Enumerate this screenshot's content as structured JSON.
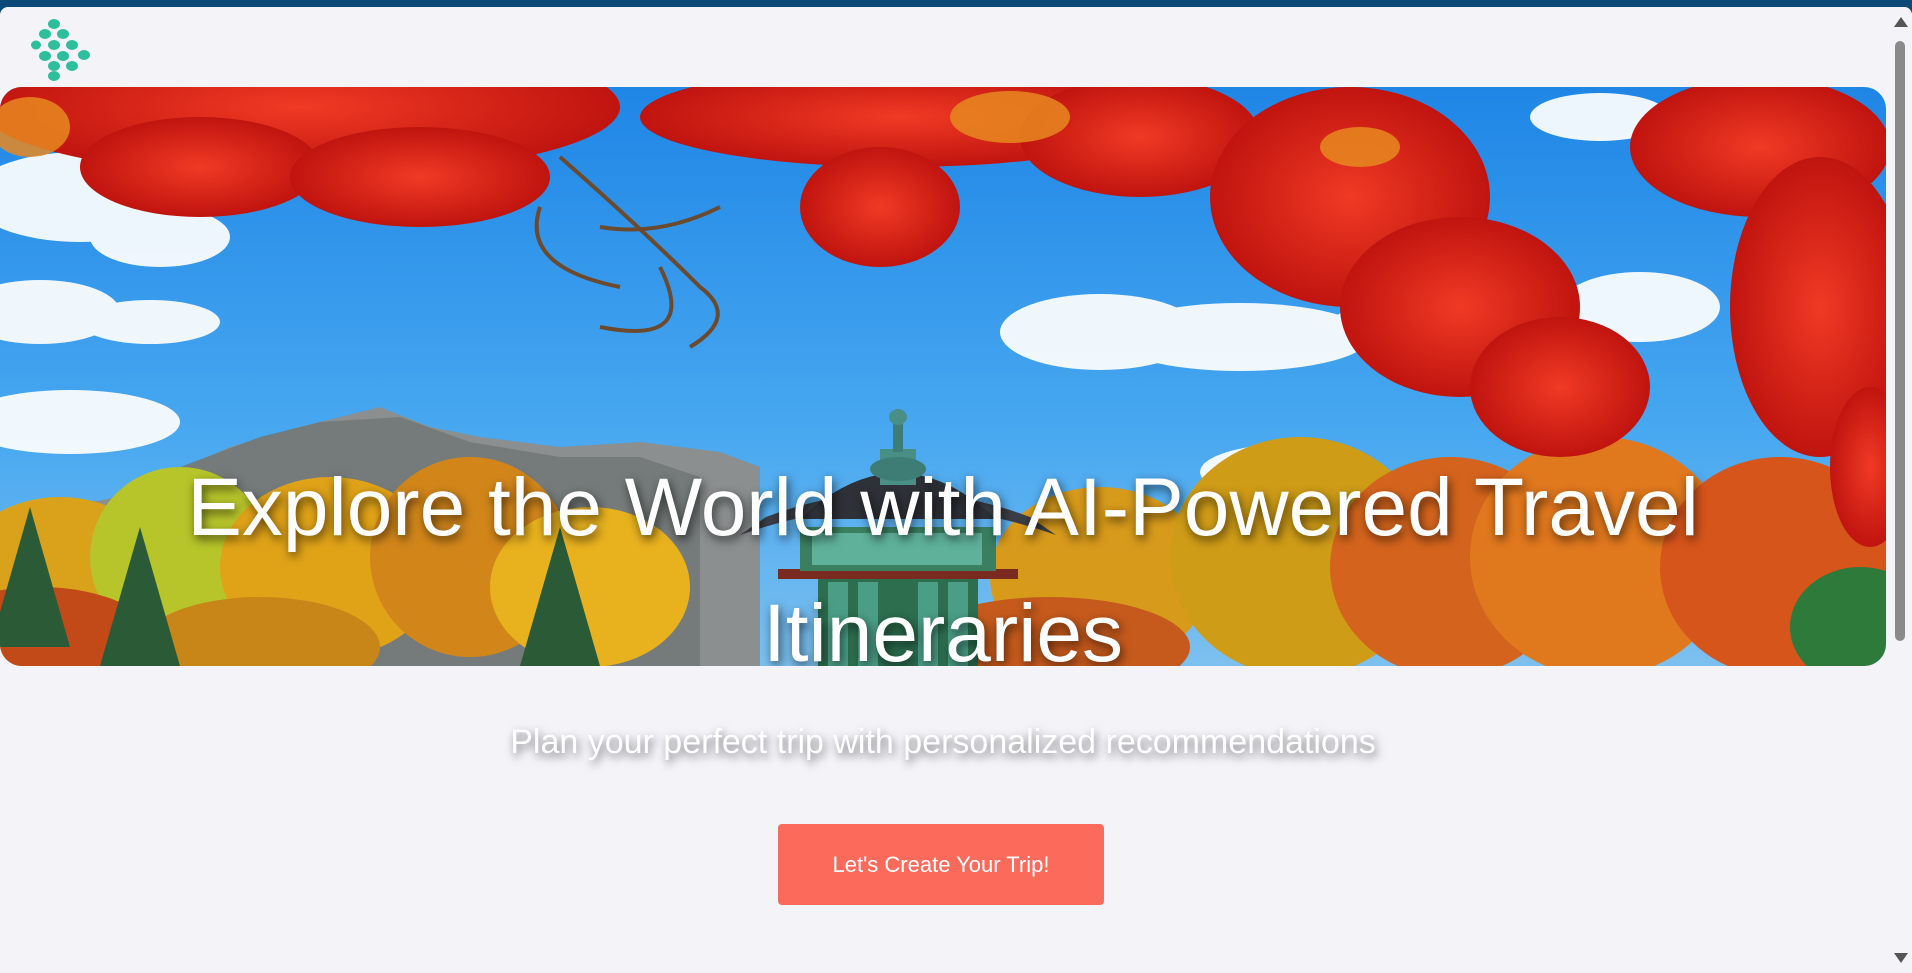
{
  "header": {
    "logo_icon": "dot-cluster-logo-icon",
    "logo_color": "#2dbf9c"
  },
  "hero": {
    "title": "Explore the World with AI-Powered Travel Itineraries",
    "image_description_icon": "pagoda-autumn-scene-image"
  },
  "main": {
    "subtitle": "Plan your perfect trip with personalized recommendations",
    "cta_label": "Let's Create Your Trip!",
    "cta_color": "#fc6a5b"
  },
  "colors": {
    "page_background": "#f4f3f8",
    "frame": "#0b4a78"
  }
}
